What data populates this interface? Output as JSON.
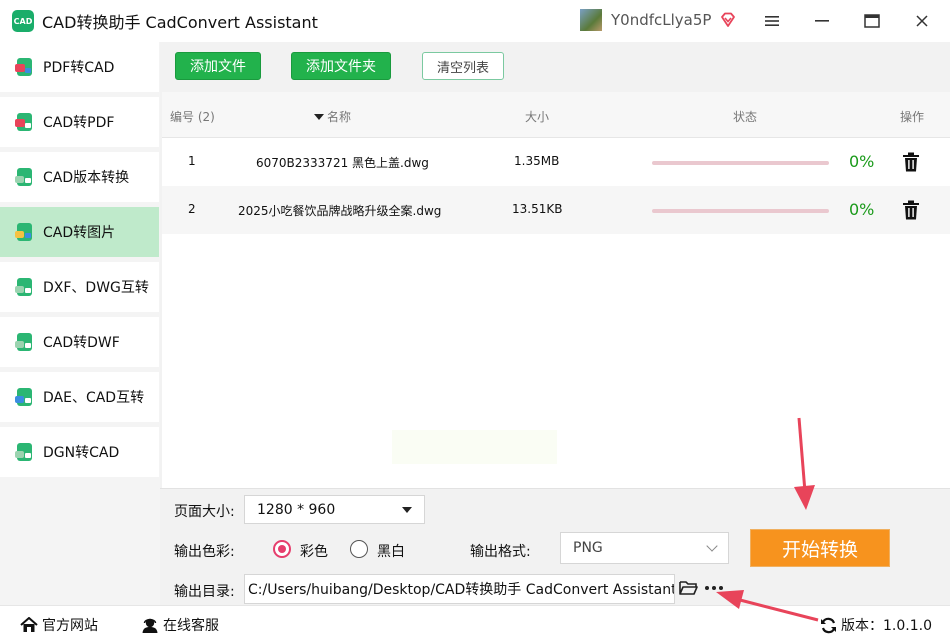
{
  "window": {
    "logo_text": "CAD",
    "title": "CAD转换助手 CadConvert Assistant",
    "username": "Y0ndfcLlya5P"
  },
  "sidebar": {
    "items": [
      {
        "label": "PDF转CAD"
      },
      {
        "label": "CAD转PDF"
      },
      {
        "label": "CAD版本转换"
      },
      {
        "label": "CAD转图片",
        "active": true
      },
      {
        "label": "DXF、DWG互转"
      },
      {
        "label": "CAD转DWF"
      },
      {
        "label": "DAE、CAD互转"
      },
      {
        "label": "DGN转CAD"
      }
    ]
  },
  "toolbar": {
    "add_file": "添加文件",
    "add_folder": "添加文件夹",
    "clear_list": "清空列表"
  },
  "table": {
    "headers": {
      "index": "编号 (2)",
      "name": "名称",
      "size": "大小",
      "status": "状态",
      "action": "操作"
    },
    "rows": [
      {
        "index": "1",
        "name": "6070B2333721 黑色上盖.dwg",
        "size": "1.35MB",
        "progress": 0,
        "percent": "0%"
      },
      {
        "index": "2",
        "name": "2025小吃餐饮品牌战略升级全案.dwg",
        "size": "13.51KB",
        "progress": 0,
        "percent": "0%"
      }
    ]
  },
  "settings": {
    "page_size_label": "页面大小:",
    "page_size_value": "1280 * 960",
    "color_label": "输出色彩:",
    "color_option_color": "彩色",
    "color_option_bw": "黑白",
    "color_selected": "彩色",
    "format_label": "输出格式:",
    "format_value": "PNG",
    "start_button": "开始转换",
    "output_dir_label": "输出目录:",
    "output_dir_value": "C:/Users/huibang/Desktop/CAD转换助手 CadConvert Assistant"
  },
  "footer": {
    "website": "官方网站",
    "support": "在线客服",
    "version": "版本：1.0.1.0"
  },
  "colors": {
    "accent_green": "#22b24c",
    "active_nav": "#bfeacb",
    "start_orange": "#f7931e",
    "radio_pink": "#e63e6d",
    "arrow_red": "#e8445a"
  }
}
